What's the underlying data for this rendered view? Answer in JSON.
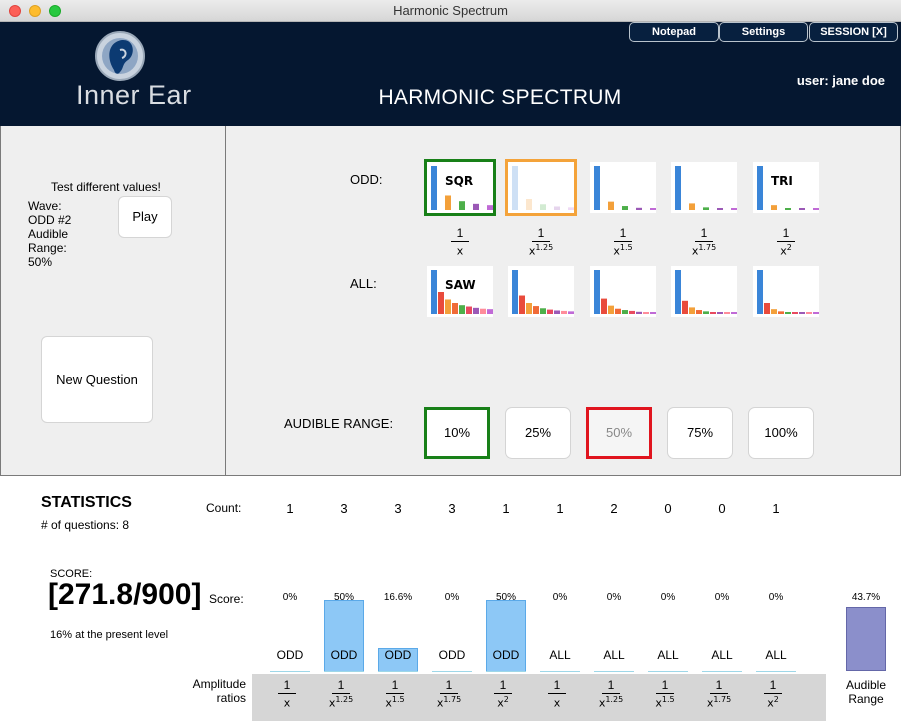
{
  "window": {
    "title": "Harmonic Spectrum"
  },
  "header": {
    "logo_text": "Inner Ear",
    "title": "HARMONIC SPECTRUM",
    "user": "user: jane doe",
    "buttons": [
      "Notepad",
      "Settings",
      "SESSION [X]"
    ]
  },
  "left": {
    "test_label": "Test different values!",
    "info": [
      "Wave:",
      "ODD #2",
      "Audible",
      "Range:",
      "50%"
    ],
    "play_label": "Play",
    "new_question_label": "New Question"
  },
  "waves": {
    "odd_label": "ODD:",
    "all_label": "ALL:",
    "odd_tiles": [
      {
        "name": "SQR",
        "state": "selected-correct"
      },
      {
        "name": "",
        "state": "selected-chosen"
      },
      {
        "name": "",
        "state": ""
      },
      {
        "name": "",
        "state": ""
      },
      {
        "name": "TRI",
        "state": ""
      }
    ],
    "all_tiles": [
      {
        "name": "SAW"
      },
      {
        "name": ""
      },
      {
        "name": ""
      },
      {
        "name": ""
      },
      {
        "name": ""
      }
    ],
    "fractions": [
      {
        "num": "1",
        "den": "x",
        "exp": ""
      },
      {
        "num": "1",
        "den": "x",
        "exp": "1.25"
      },
      {
        "num": "1",
        "den": "x",
        "exp": "1.5"
      },
      {
        "num": "1",
        "den": "x",
        "exp": "1.75"
      },
      {
        "num": "1",
        "den": "x",
        "exp": "2"
      }
    ]
  },
  "audible_range": {
    "label": "AUDIBLE RANGE:",
    "options": [
      "10%",
      "25%",
      "50%",
      "75%",
      "100%"
    ]
  },
  "statistics": {
    "title": "STATISTICS",
    "questions": "# of questions: 8",
    "count_label": "Count:",
    "counts": [
      "1",
      "3",
      "3",
      "3",
      "1",
      "1",
      "2",
      "0",
      "0",
      "1"
    ],
    "score_small": "SCORE:",
    "score_big": "[271.8/900]",
    "score_level": "16% at the present level",
    "score_label": "Score:",
    "columns": [
      {
        "pct": "0%",
        "value": 0,
        "wave": "ODD"
      },
      {
        "pct": "50%",
        "value": 50,
        "wave": "ODD"
      },
      {
        "pct": "16.6%",
        "value": 16.6,
        "wave": "ODD"
      },
      {
        "pct": "0%",
        "value": 0,
        "wave": "ODD"
      },
      {
        "pct": "50%",
        "value": 50,
        "wave": "ODD"
      },
      {
        "pct": "0%",
        "value": 0,
        "wave": "ALL"
      },
      {
        "pct": "0%",
        "value": 0,
        "wave": "ALL"
      },
      {
        "pct": "0%",
        "value": 0,
        "wave": "ALL"
      },
      {
        "pct": "0%",
        "value": 0,
        "wave": "ALL"
      },
      {
        "pct": "0%",
        "value": 0,
        "wave": "ALL"
      }
    ],
    "audible_pct": "43.7%",
    "audible_label_1": "Audible",
    "audible_label_2": "Range",
    "amp_label_1": "Amplitude",
    "amp_label_2": "ratios",
    "amp_fracs": [
      {
        "num": "1",
        "den": "x",
        "exp": ""
      },
      {
        "num": "1",
        "den": "x",
        "exp": "1.25"
      },
      {
        "num": "1",
        "den": "x",
        "exp": "1.5"
      },
      {
        "num": "1",
        "den": "x",
        "exp": "1.75"
      },
      {
        "num": "1",
        "den": "x",
        "exp": "2"
      },
      {
        "num": "1",
        "den": "x",
        "exp": ""
      },
      {
        "num": "1",
        "den": "x",
        "exp": "1.25"
      },
      {
        "num": "1",
        "den": "x",
        "exp": "1.5"
      },
      {
        "num": "1",
        "den": "x",
        "exp": "1.75"
      },
      {
        "num": "1",
        "den": "x",
        "exp": "2"
      }
    ]
  }
}
